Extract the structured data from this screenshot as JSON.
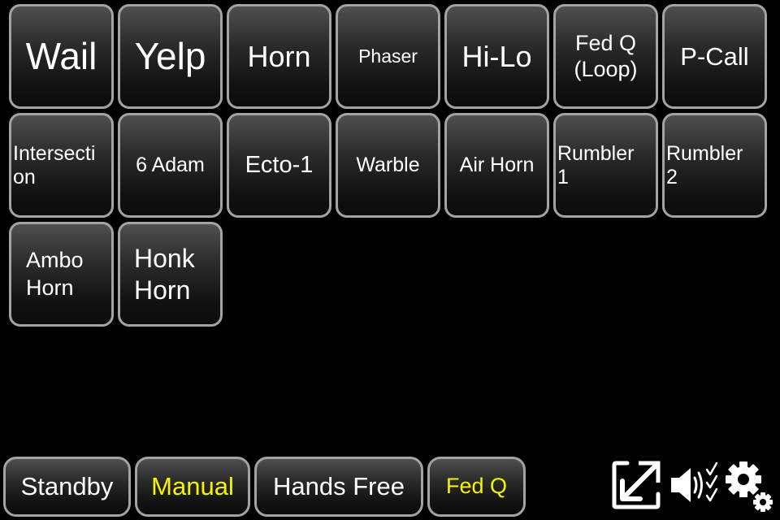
{
  "sound_buttons": [
    {
      "label": "Wail"
    },
    {
      "label": "Yelp"
    },
    {
      "label": "Horn"
    },
    {
      "label": "Phaser"
    },
    {
      "label": "Hi-Lo"
    },
    {
      "label": "Fed Q (Loop)",
      "line1": "Fed Q",
      "line2": "(Loop)"
    },
    {
      "label": "P-Call"
    },
    {
      "label": "Intersection",
      "line1": "Intersecti",
      "line2": "on"
    },
    {
      "label": "6 Adam"
    },
    {
      "label": "Ecto-1"
    },
    {
      "label": "Warble"
    },
    {
      "label": "Air Horn"
    },
    {
      "label": "Rumbler 1",
      "line1": "Rumbler",
      "line2": "1"
    },
    {
      "label": "Rumbler 2",
      "line1": "Rumbler",
      "line2": "2"
    },
    {
      "label": "Ambo Horn",
      "line1": "Ambo",
      "line2": "Horn"
    },
    {
      "label": "Honk Horn",
      "line1": "Honk",
      "line2": "Horn"
    }
  ],
  "mode_buttons": [
    {
      "label": "Standby",
      "active": false
    },
    {
      "label": "Manual",
      "active": true
    },
    {
      "label": "Hands Free",
      "active": false
    },
    {
      "label": "Fed Q",
      "active": true
    }
  ],
  "toolbar_icons": [
    {
      "name": "resize-icon"
    },
    {
      "name": "sound-settings-icon"
    },
    {
      "name": "settings-gears-icon"
    }
  ],
  "colors": {
    "background": "#000000",
    "button_border": "#a3a3a3",
    "text_default": "#ffffff",
    "text_active": "#f5f500"
  }
}
